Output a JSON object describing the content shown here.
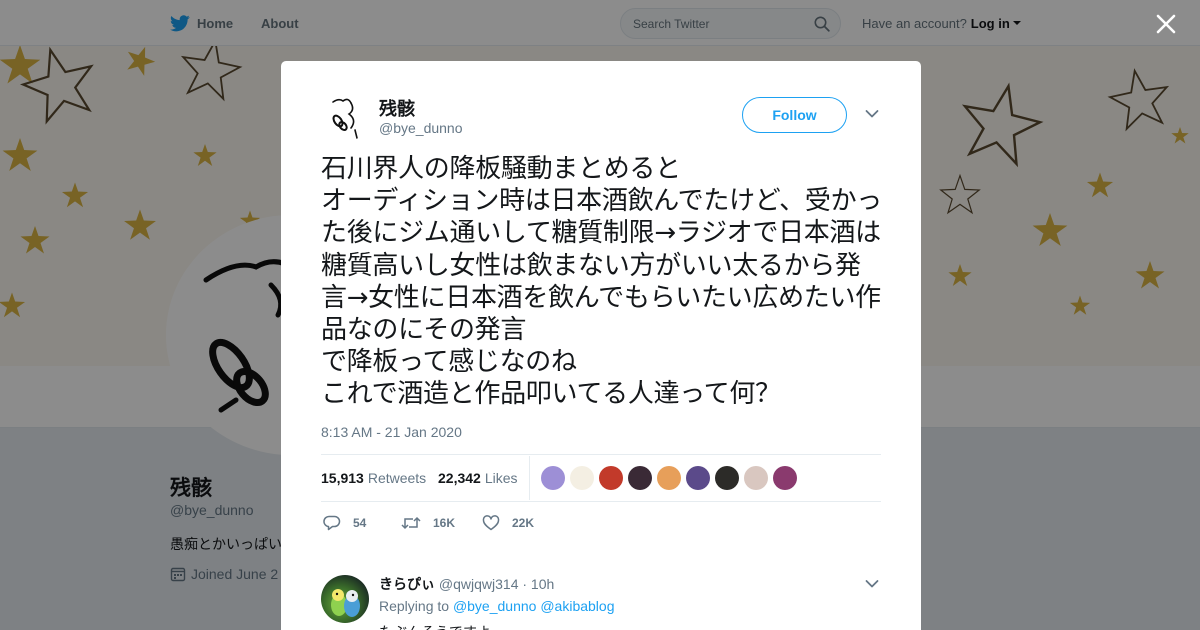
{
  "topbar": {
    "home_label": "Home",
    "about_label": "About",
    "search_placeholder": "Search Twitter",
    "have_account": "Have an account?",
    "login_label": "Log in"
  },
  "profile": {
    "name": "残骸",
    "handle": "@bye_dunno",
    "bio": "愚痴とかいっぱい",
    "joined": "Joined June 2"
  },
  "tweet": {
    "author_name": "残骸",
    "author_handle": "@bye_dunno",
    "follow_label": "Follow",
    "text": "石川界人の降板騒動まとめると\nオーディション時は日本酒飲んでたけど、受かった後にジム通いして糖質制限→ラジオで日本酒は糖質高いし女性は飲まない方がいい太るから発言→女性に日本酒を飲んでもらいたい広めたい作品なのにその発言\nで降板って感じなのね\nこれで酒造と作品叩いてる人達って何？",
    "timestamp": "8:13 AM - 21 Jan 2020",
    "retweets_count": "15,913",
    "retweets_label": "Retweets",
    "likes_count": "22,342",
    "likes_label": "Likes",
    "reply_count": "54",
    "retweet_count_short": "16K",
    "like_count_short": "22K",
    "liker_avatar_colors": [
      "#9d8fd6",
      "#f4efe3",
      "#c23a2a",
      "#3a2a36",
      "#e79f5a",
      "#5b4a8a",
      "#2c2b28",
      "#d9c7c0",
      "#8a3a6e"
    ]
  },
  "reply": {
    "name": "きらぴぃ",
    "handle": "@qwjqwj314",
    "time": "· 10h",
    "replying_to_label": "Replying to",
    "mention_1": "@bye_dunno",
    "mention_2": "@akibablog",
    "text": "たぶんそうですよ"
  }
}
